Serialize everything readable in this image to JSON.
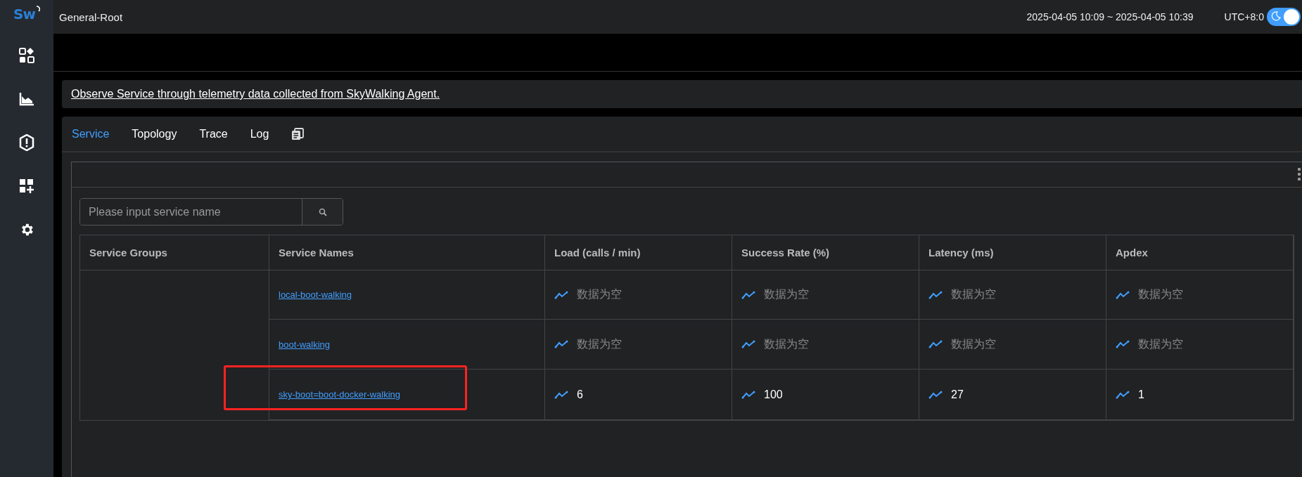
{
  "logo": "Sw",
  "header": {
    "title": "General-Root",
    "time_range": "2025-04-05 10:09 ~ 2025-04-05 10:39",
    "timezone": "UTC+8:0",
    "dark_mode": true
  },
  "description": "Observe Service through telemetry data collected from SkyWalking Agent.",
  "tabs": [
    {
      "label": "Service",
      "selected": true
    },
    {
      "label": "Topology",
      "selected": false
    },
    {
      "label": "Trace",
      "selected": false
    },
    {
      "label": "Log",
      "selected": false
    }
  ],
  "search": {
    "placeholder": "Please input service name"
  },
  "table": {
    "columns": [
      "Service Groups",
      "Service Names",
      "Load (calls / min)",
      "Success Rate (%)",
      "Latency (ms)",
      "Apdex"
    ],
    "rows": [
      {
        "name": "local-boot-walking",
        "highlighted": false,
        "metrics": [
          {
            "value": "数据为空",
            "empty": true
          },
          {
            "value": "数据为空",
            "empty": true
          },
          {
            "value": "数据为空",
            "empty": true
          },
          {
            "value": "数据为空",
            "empty": true
          }
        ]
      },
      {
        "name": "boot-walking",
        "highlighted": false,
        "metrics": [
          {
            "value": "数据为空",
            "empty": true
          },
          {
            "value": "数据为空",
            "empty": true
          },
          {
            "value": "数据为空",
            "empty": true
          },
          {
            "value": "数据为空",
            "empty": true
          }
        ]
      },
      {
        "name": "sky-boot=boot-docker-walking",
        "highlighted": true,
        "metrics": [
          {
            "value": "6",
            "empty": false
          },
          {
            "value": "100",
            "empty": false
          },
          {
            "value": "27",
            "empty": false
          },
          {
            "value": "1",
            "empty": false
          }
        ]
      }
    ]
  }
}
